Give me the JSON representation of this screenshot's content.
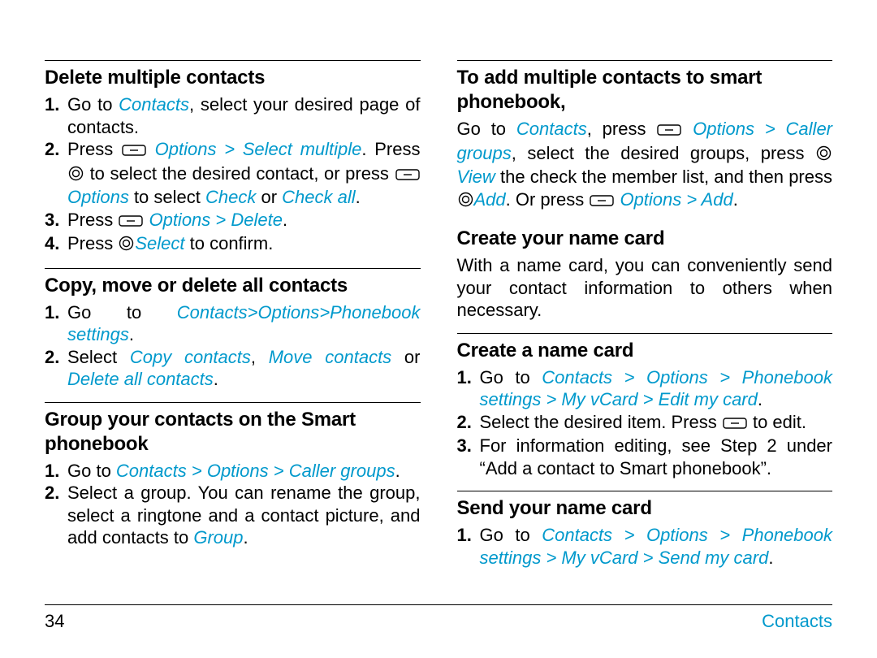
{
  "page_number": "34",
  "footer_section": "Contacts",
  "left": {
    "h1": "Delete multiple contacts",
    "s1": {
      "l1a": "Go to ",
      "l1b": "Contacts",
      "l1c": ", select your desired page of contacts.",
      "l2a": "Press ",
      "l2b": " Options",
      "l2c": " > ",
      "l2d": "Select multiple",
      "l2e": ". Press ",
      "l2f": " to select the desired contact, or press ",
      "l2g": " Options",
      "l2h": " to select ",
      "l2i": "Check",
      "l2j": " or ",
      "l2k": "Check all",
      "l2l": ".",
      "l3a": "Press ",
      "l3b": " Options",
      "l3c": " > ",
      "l3d": "Delete",
      "l3e": ".",
      "l4a": "Press ",
      "l4b": "Select",
      "l4c": " to confirm."
    },
    "h2": "Copy, move or delete all contacts",
    "s2": {
      "l1a": "Go to ",
      "l1b": "Contacts",
      "l1c": ">",
      "l1d": "Options",
      "l1e": ">",
      "l1f": "Phonebook settings",
      "l1g": ".",
      "l2a": "Select ",
      "l2b": "Copy contacts",
      "l2c": ", ",
      "l2d": "Move contacts",
      "l2e": " or ",
      "l2f": "Delete all contacts",
      "l2g": "."
    },
    "h3": "Group your contacts on the Smart phonebook",
    "s3": {
      "l1a": "Go to ",
      "l1b": "Contacts",
      "l1c": " > ",
      "l1d": "Options",
      "l1e": " > ",
      "l1f": "Caller groups",
      "l1g": ".",
      "l2a": "Select a group. You can rename the group, select a ringtone and a contact picture, and add contacts to ",
      "l2b": "Group",
      "l2c": "."
    }
  },
  "right": {
    "h1": "To add multiple contacts to smart phonebook,",
    "p1": {
      "a": "Go to ",
      "b": "Contacts",
      "c": ", press ",
      "d": " Options",
      "e": " > ",
      "f": "Caller groups",
      "g": ", select the desired groups, press ",
      "h": "View",
      "i": " the check the member list, and then press ",
      "j": "Add",
      "k": ". Or press ",
      "l": " Options",
      "m": " > ",
      "n": "Add",
      "o": "."
    },
    "h2": "Create your name card",
    "p2": "With a name card, you can conveniently send your contact information to others when necessary.",
    "h3": "Create a name card",
    "s3": {
      "l1a": "Go to ",
      "l1b": "Contacts",
      "l1c": " > ",
      "l1d": "Options",
      "l1e": " > ",
      "l1f": "Phonebook settings",
      "l1g": " > ",
      "l1h": "My vCard",
      "l1i": " > ",
      "l1j": "Edit my card",
      "l1k": ".",
      "l2a": "Select the desired item. Press ",
      "l2b": " to edit.",
      "l3": "For information editing, see Step 2 under “Add a contact to Smart phonebook”."
    },
    "h4": "Send your name card",
    "s4": {
      "l1a": "Go to ",
      "l1b": "Contacts",
      "l1c": " > ",
      "l1d": "Options",
      "l1e": " > ",
      "l1f": "Phonebook settings",
      "l1g": " > ",
      "l1h": "My vCard",
      "l1i": " > ",
      "l1j": "Send my card",
      "l1k": "."
    }
  }
}
